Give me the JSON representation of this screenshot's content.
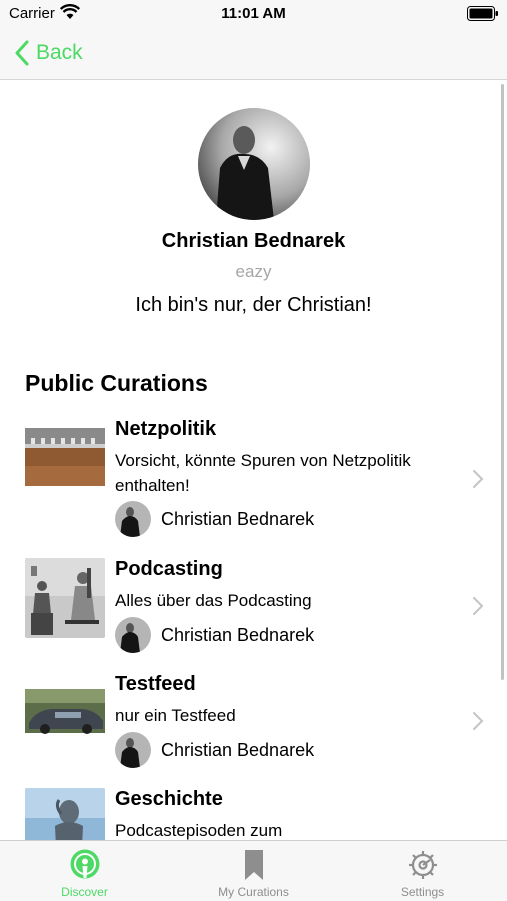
{
  "colors": {
    "accent": "#4cd964",
    "secondary_text": "#a6a6a6",
    "inactive_tab": "#8e8e8e"
  },
  "status_bar": {
    "carrier": "Carrier",
    "time": "11:01 AM"
  },
  "nav": {
    "back_label": "Back"
  },
  "profile": {
    "name": "Christian Bednarek",
    "handle": "eazy",
    "bio": "Ich bin's nur, der Christian!"
  },
  "section": {
    "title": "Public Curations"
  },
  "curations": [
    {
      "title": "Netzpolitik",
      "description": "Vorsicht, könnte Spuren von Netzpolitik enthalten!",
      "author": "Christian Bednarek"
    },
    {
      "title": "Podcasting",
      "description": "Alles über das Podcasting",
      "author": "Christian Bednarek"
    },
    {
      "title": "Testfeed",
      "description": "nur ein Testfeed",
      "author": "Christian Bednarek"
    },
    {
      "title": "Geschichte",
      "description": "Podcastepisoden zum",
      "author": ""
    }
  ],
  "tabs": [
    {
      "label": "Discover",
      "icon": "podcast-icon",
      "active": true
    },
    {
      "label": "My Curations",
      "icon": "bookmark-icon",
      "active": false
    },
    {
      "label": "Settings",
      "icon": "gear-icon",
      "active": false
    }
  ]
}
